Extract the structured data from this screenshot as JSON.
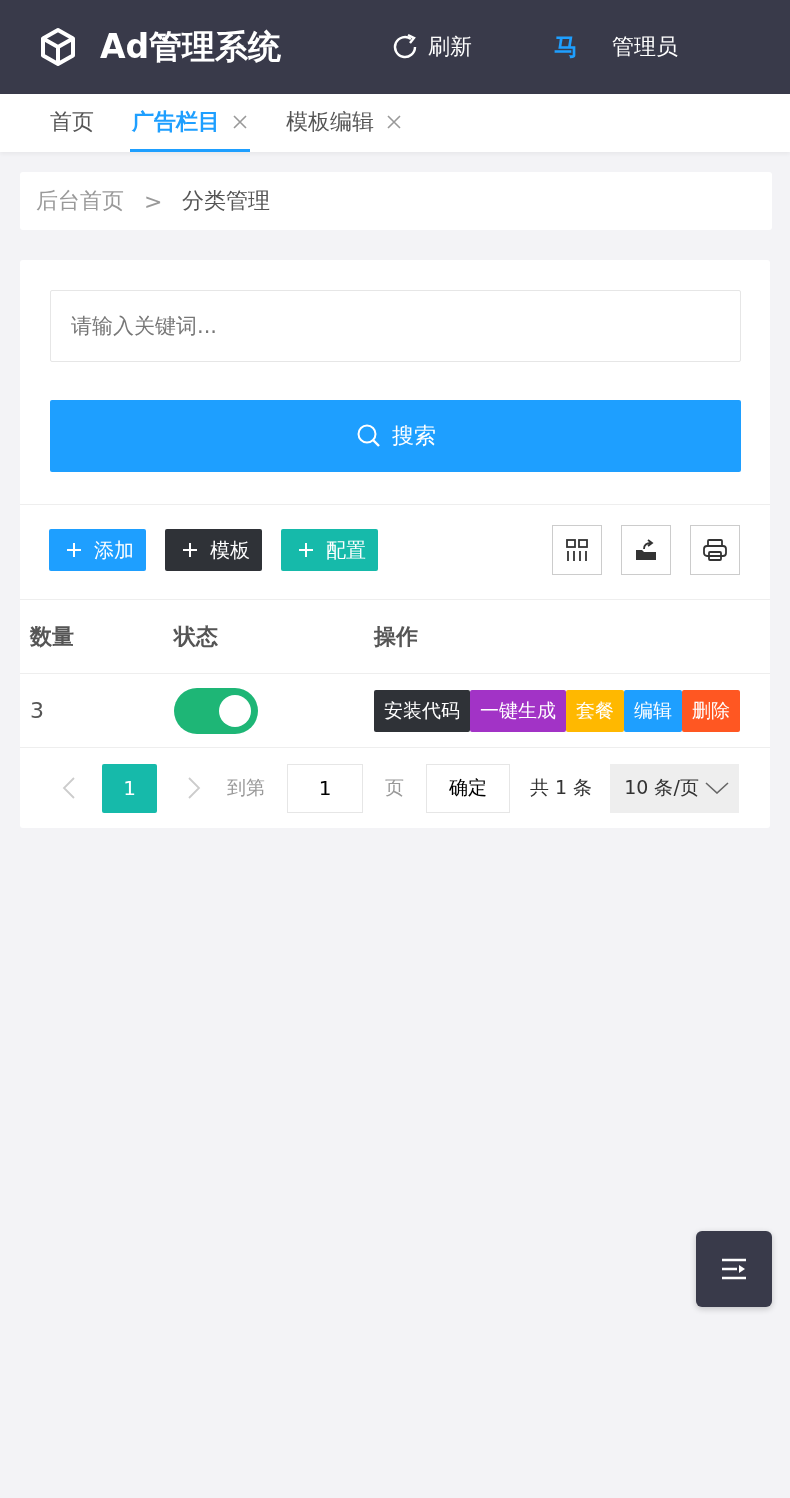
{
  "header": {
    "title": "Ad管理系统",
    "refresh": "刷新",
    "avatar": "马",
    "user": "管理员"
  },
  "tabs": [
    {
      "label": "首页",
      "selected": false,
      "closable": false
    },
    {
      "label": "广告栏目",
      "selected": true,
      "closable": true
    },
    {
      "label": "模板编辑",
      "selected": false,
      "closable": true
    }
  ],
  "breadcrumb": [
    "后台首页",
    "分类管理"
  ],
  "breadcrumb_separator": ">",
  "search": {
    "placeholder": "请输入关键词...",
    "button": "搜索"
  },
  "toolbar": {
    "buttons": [
      {
        "label": "添加",
        "color": "#1e9fff"
      },
      {
        "label": "模板",
        "color": "#2f3237"
      },
      {
        "label": "配置",
        "color": "#16baaa"
      }
    ]
  },
  "table": {
    "columns": [
      "数量",
      "状态",
      "操作"
    ],
    "rows": [
      {
        "count": "3",
        "on": true,
        "actions": [
          {
            "label": "安装代码",
            "color": "#2f3237"
          },
          {
            "label": "一键生成",
            "color": "#a233c6"
          },
          {
            "label": "套餐",
            "color": "#ffb800"
          },
          {
            "label": "编辑",
            "color": "#1e9fff"
          },
          {
            "label": "删除",
            "color": "#ff5722"
          }
        ]
      }
    ]
  },
  "pagination": {
    "prev_disabled": true,
    "next_disabled": true,
    "pages": [
      {
        "label": "1",
        "selected": true
      }
    ],
    "goto_label": "到第",
    "goto_value": "1",
    "page_unit": "页",
    "confirm": "确定",
    "total": "共 1 条",
    "page_size": "10 条/页"
  }
}
